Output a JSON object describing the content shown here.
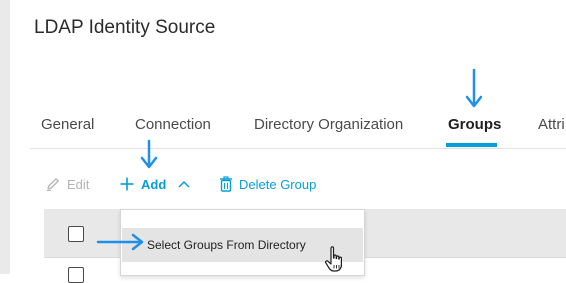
{
  "page": {
    "title": "LDAP Identity Source"
  },
  "tabs": [
    {
      "label": "General"
    },
    {
      "label": "Connection"
    },
    {
      "label": "Directory Organization"
    },
    {
      "label": "Groups",
      "active": true
    },
    {
      "label": "Attri"
    }
  ],
  "toolbar": {
    "edit_label": "Edit",
    "add_label": "Add",
    "delete_label": "Delete Group"
  },
  "dropdown": {
    "items": [
      {
        "label": "Select Groups From Directory"
      }
    ]
  },
  "colors": {
    "accent": "#049fd9",
    "annotation_arrow": "#1e90e8",
    "disabled": "#b3b3b5"
  },
  "icons": {
    "edit": "pencil-icon",
    "add": "plus-icon",
    "collapse": "chevron-up-icon",
    "delete": "trash-icon",
    "cursor": "hand-pointer-icon",
    "annotation": "arrow-icon"
  }
}
